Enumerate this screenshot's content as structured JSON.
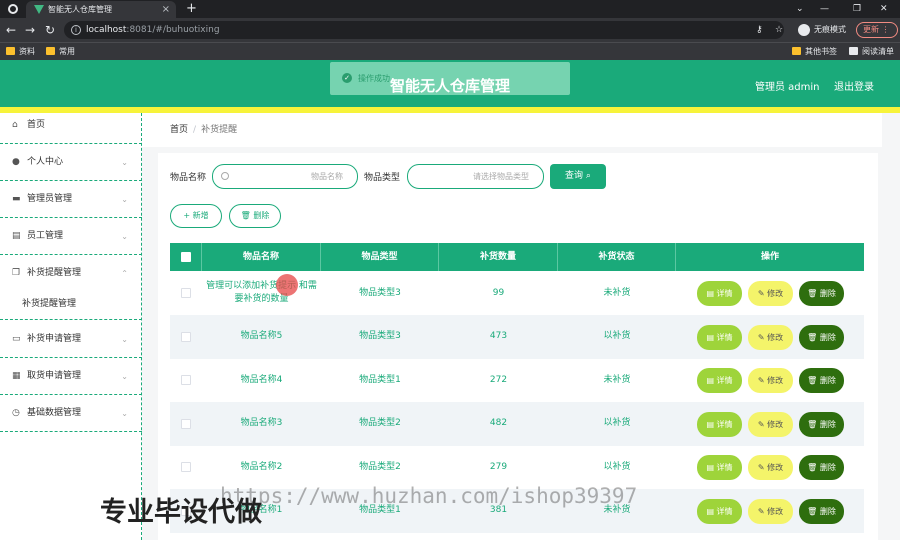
{
  "browser": {
    "tab_title": "智能无人仓库管理",
    "url_host": "localhost",
    "url_rest": ":8081/#/buhuotixing",
    "profile_label": "无痕模式",
    "update_label": "更新",
    "bookmarks": [
      "资料",
      "常用"
    ],
    "bookmarks_right": [
      "其他书签",
      "阅读清单"
    ]
  },
  "header": {
    "title": "智能无人仓库管理",
    "admin_label": "管理员 admin",
    "logout_label": "退出登录",
    "accent_color": "#1aaa7a",
    "strip_color": "#f7f33a"
  },
  "toast": {
    "message": "操作成功"
  },
  "sidebar": {
    "items": [
      {
        "label": "首页"
      },
      {
        "label": "个人中心"
      },
      {
        "label": "管理员管理"
      },
      {
        "label": "员工管理"
      },
      {
        "label": "补货提醒管理"
      },
      {
        "label": "补货提醒管理"
      },
      {
        "label": "补货申请管理"
      },
      {
        "label": "取货申请管理"
      },
      {
        "label": "基础数据管理"
      }
    ]
  },
  "breadcrumb": {
    "home": "首页",
    "separator": "/",
    "current": "补货提醒"
  },
  "search": {
    "name_label": "物品名称",
    "name_placeholder": "物品名称",
    "type_label": "物品类型",
    "type_placeholder": "请选择物品类型",
    "query_label": "查询"
  },
  "actions": {
    "add_label": "+ 新增",
    "delete_label": "删除"
  },
  "table": {
    "columns": [
      "物品名称",
      "物品类型",
      "补货数量",
      "补货状态",
      "操作"
    ],
    "op_labels": {
      "detail": "详情",
      "edit": "修改",
      "delete": "删除"
    },
    "rows": [
      {
        "name": "管理可以添加补货提示 和需要补货的数量",
        "type": "物品类型3",
        "qty": "99",
        "status": "未补货"
      },
      {
        "name": "物品名称5",
        "type": "物品类型3",
        "qty": "473",
        "status": "以补货"
      },
      {
        "name": "物品名称4",
        "type": "物品类型1",
        "qty": "272",
        "status": "未补货"
      },
      {
        "name": "物品名称3",
        "type": "物品类型2",
        "qty": "482",
        "status": "以补货"
      },
      {
        "name": "物品名称2",
        "type": "物品类型2",
        "qty": "279",
        "status": "以补货"
      },
      {
        "name": "物品名称1",
        "type": "物品类型1",
        "qty": "381",
        "status": "未补货"
      }
    ]
  },
  "watermark": {
    "url": "https://www.huzhan.com/ishop39397",
    "text": "专业毕设代做"
  }
}
